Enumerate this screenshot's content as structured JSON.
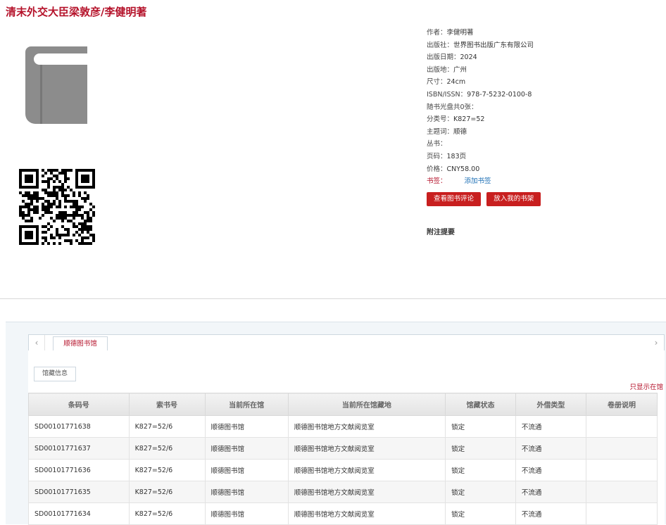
{
  "book": {
    "title": "清末外交大臣梁敦彦/李健明著"
  },
  "details": [
    {
      "label": "作者：",
      "value": "李健明著"
    },
    {
      "label": "出版社：",
      "value": "世界图书出版广东有限公司"
    },
    {
      "label": "出版日期：",
      "value": "2024"
    },
    {
      "label": "出版地：",
      "value": "广州"
    },
    {
      "label": "尺寸：",
      "value": "24cm"
    },
    {
      "label": "ISBN/ISSN：",
      "value": "978-7-5232-0100-8"
    },
    {
      "label": "随书光盘共0张：",
      "value": ""
    },
    {
      "label": "分类号：",
      "value": "K827=52"
    },
    {
      "label": "主题词：",
      "value": "顺德"
    },
    {
      "label": "丛书：",
      "value": ""
    },
    {
      "label": "页码：",
      "value": "183页"
    },
    {
      "label": "价格：",
      "value": "CNY58.00"
    }
  ],
  "bookmark": {
    "label": "书签：",
    "add_label": "添加书签"
  },
  "buttons": {
    "review": "查看图书评论",
    "shelf": "放入我的书架"
  },
  "notes_title": "附注提要",
  "library_tab": "顺德图书馆",
  "tab_arrows": {
    "left": "‹",
    "right": "›"
  },
  "holdings_tab": "馆藏信息",
  "only_show_link": "只显示在馆",
  "table": {
    "headers": [
      "条码号",
      "索书号",
      "当前所在馆",
      "当前所在馆藏地",
      "馆藏状态",
      "外借类型",
      "卷册说明"
    ],
    "rows": [
      [
        "SD00101771638",
        "K827=52/6",
        "顺德图书馆",
        "顺德图书馆地方文献阅览室",
        "锁定",
        "不流通",
        ""
      ],
      [
        "SD00101771637",
        "K827=52/6",
        "顺德图书馆",
        "顺德图书馆地方文献阅览室",
        "锁定",
        "不流通",
        ""
      ],
      [
        "SD00101771636",
        "K827=52/6",
        "顺德图书馆",
        "顺德图书馆地方文献阅览室",
        "锁定",
        "不流通",
        ""
      ],
      [
        "SD00101771635",
        "K827=52/6",
        "顺德图书馆",
        "顺德图书馆地方文献阅览室",
        "锁定",
        "不流通",
        ""
      ],
      [
        "SD00101771634",
        "K827=52/6",
        "顺德图书馆",
        "顺德图书馆地方文献阅览室",
        "锁定",
        "不流通",
        ""
      ]
    ]
  },
  "images": {
    "cover_icon": "book-icon",
    "qr_code": "qr-code"
  },
  "colors": {
    "accent": "#b5132b",
    "button": "#c81f1f",
    "link": "#1c6fb5"
  }
}
